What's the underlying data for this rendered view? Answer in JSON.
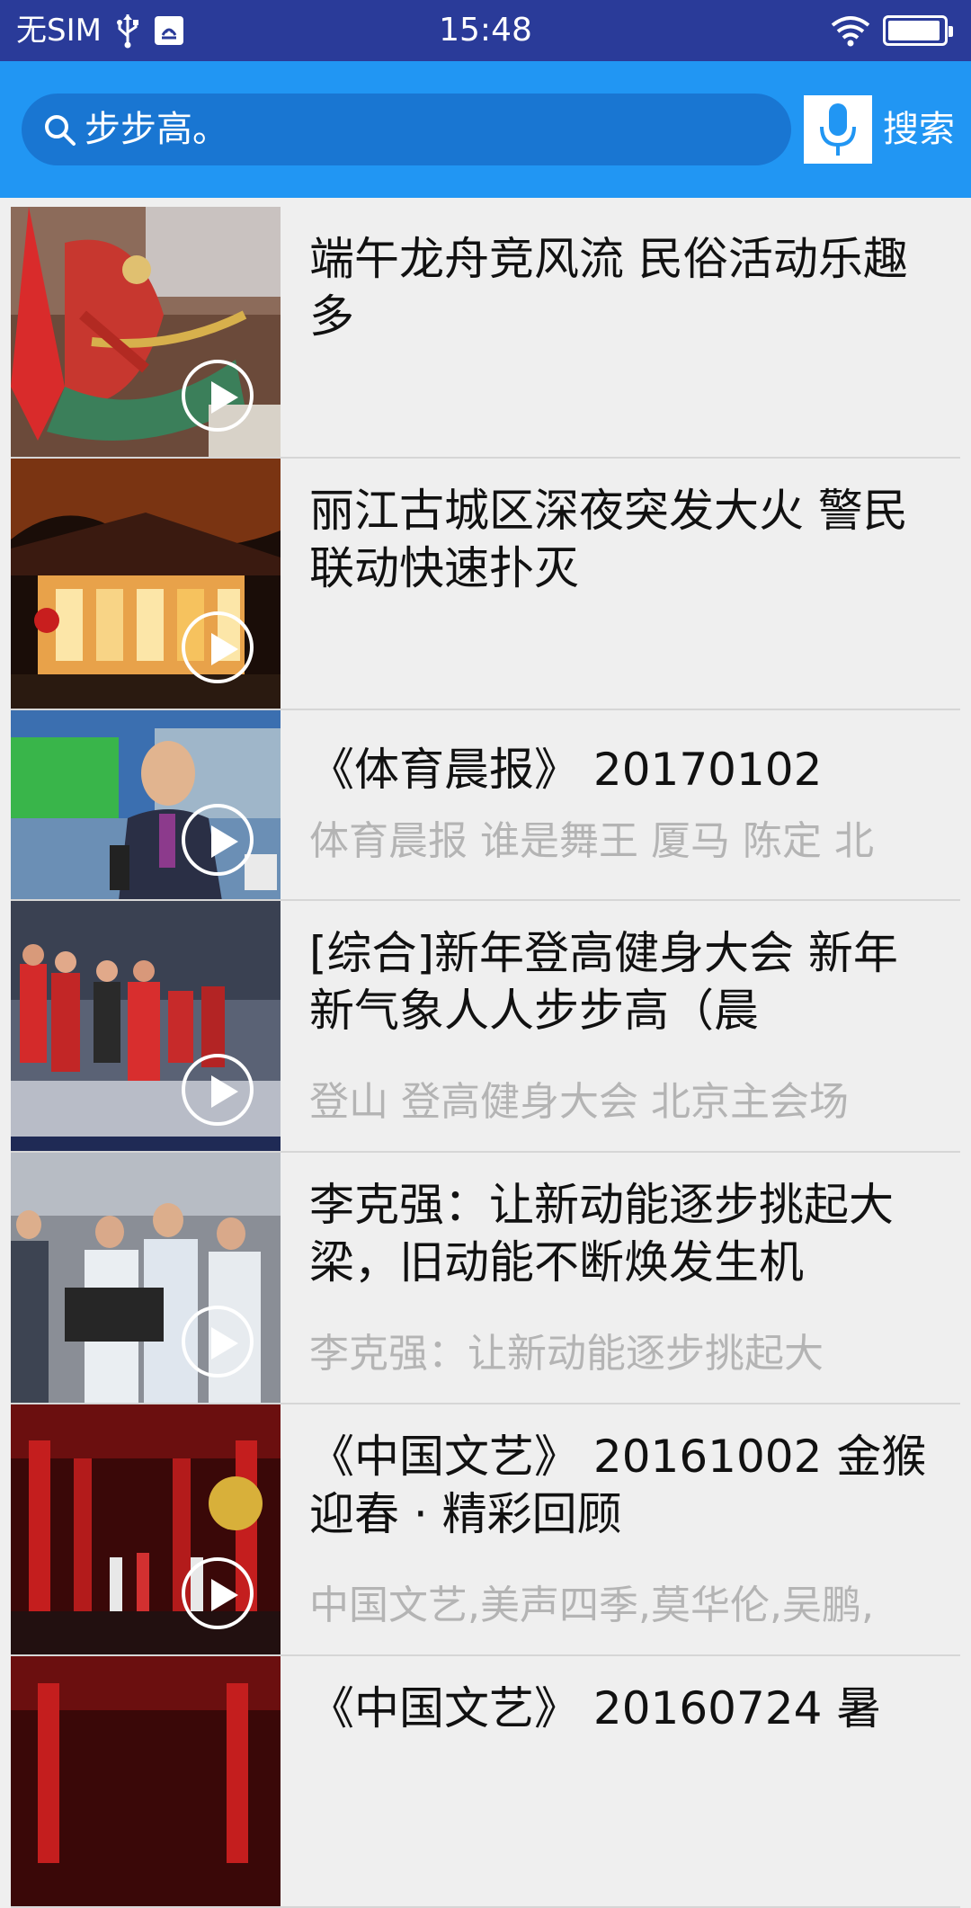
{
  "status_bar": {
    "carrier": "无SIM",
    "time": "15:48",
    "battery_level": 0.95
  },
  "search": {
    "query": "步步高。",
    "search_label": "搜索"
  },
  "videos": [
    {
      "title": "端午龙舟竞风流 民俗活动乐趣多",
      "desc": ""
    },
    {
      "title": "丽江古城区深夜突发大火 警民联动快速扑灭",
      "desc": ""
    },
    {
      "title": "《体育晨报》 20170102",
      "desc": "体育晨报 谁是舞王 厦马 陈定 北"
    },
    {
      "title": "[综合]新年登高健身大会 新年新气象人人步步高（晨",
      "desc": "登山 登高健身大会 北京主会场"
    },
    {
      "title": "李克强：让新动能逐步挑起大梁，旧动能不断焕发生机",
      "desc": "李克强：让新动能逐步挑起大"
    },
    {
      "title": "《中国文艺》 20161002 金猴迎春 · 精彩回顾",
      "desc": "中国文艺,美声四季,莫华伦,吴鹏,"
    },
    {
      "title": "《中国文艺》 20160724 暑",
      "desc": ""
    }
  ],
  "colors": {
    "status_bar": "#2a3b99",
    "search_bar": "#2196f3",
    "search_box": "#1976d2",
    "list_background": "#efefef"
  }
}
